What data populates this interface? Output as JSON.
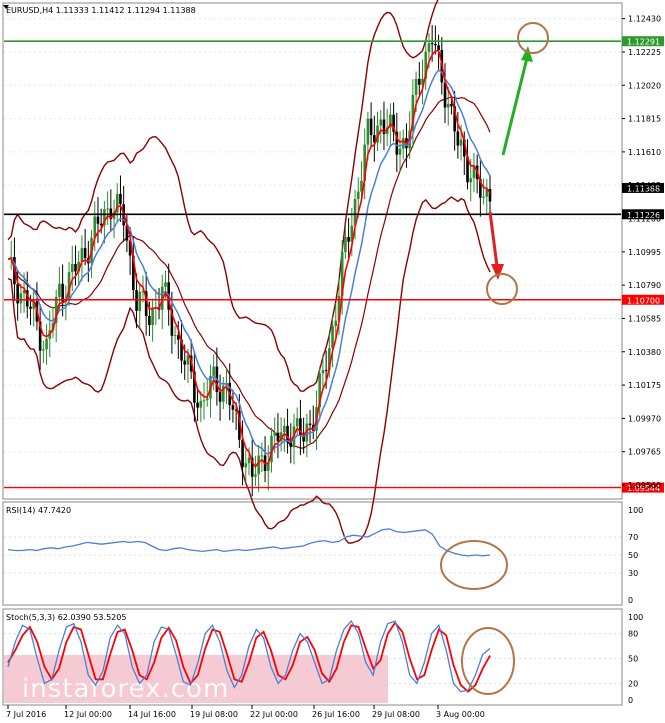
{
  "window": {
    "symbol_header": "EURUSD,H4  1.11333 1.11412 1.11294 1.11388"
  },
  "price_axis": {
    "ticks": [
      "1.12430",
      "1.12225",
      "1.12020",
      "1.11815",
      "1.11610",
      "1.11405",
      "1.11200",
      "1.10995",
      "1.10790",
      "1.10585",
      "1.10380",
      "1.10175",
      "1.09970",
      "1.09765",
      "1.09560"
    ],
    "price_min": 1.0948,
    "price_max": 1.1252
  },
  "levels": {
    "resistance": {
      "label": "1.12291",
      "price": 1.12291,
      "color": "#2e9a2e"
    },
    "current": {
      "label": "1.11388",
      "price": 1.11388,
      "color": "#000000"
    },
    "pivot": {
      "label": "1.11226",
      "price": 1.11226,
      "color": "#000000"
    },
    "support1": {
      "label": "1.10700",
      "price": 1.107,
      "color": "#ff0000"
    },
    "support2": {
      "label": "1.09544",
      "price": 1.09544,
      "color": "#ff0000"
    }
  },
  "rsi": {
    "header": "RSI(14) 47.7420",
    "ticks": [
      "100",
      "70",
      "50",
      "30",
      "0"
    ],
    "values": [
      56,
      55,
      55,
      56,
      55,
      57,
      58,
      57,
      59,
      60,
      62,
      64,
      63,
      62,
      63,
      64,
      65,
      64,
      65,
      64,
      60,
      56,
      55,
      57,
      58,
      56,
      55,
      54,
      55,
      56,
      54,
      55,
      56,
      55,
      56,
      57,
      58,
      59,
      57,
      58,
      59,
      60,
      63,
      65,
      66,
      64,
      65,
      70,
      72,
      71,
      70,
      74,
      78,
      79,
      76,
      75,
      76,
      77,
      78,
      73,
      60,
      55,
      52,
      50,
      49,
      50,
      49,
      50
    ]
  },
  "stoch": {
    "header": "Stoch(5,3,3) 62.0390 53.5205",
    "ticks": [
      "100",
      "80",
      "50",
      "20",
      "0"
    ],
    "main": [
      40,
      70,
      90,
      85,
      50,
      20,
      25,
      60,
      88,
      92,
      70,
      30,
      18,
      35,
      75,
      90,
      80,
      40,
      20,
      30,
      70,
      88,
      85,
      55,
      22,
      18,
      45,
      80,
      90,
      70,
      35,
      15,
      30,
      65,
      85,
      75,
      40,
      20,
      30,
      60,
      80,
      70,
      45,
      20,
      25,
      60,
      85,
      95,
      80,
      45,
      30,
      70,
      92,
      95,
      70,
      30,
      20,
      45,
      80,
      90,
      60,
      20,
      10,
      12,
      30,
      55,
      62
    ],
    "signal": [
      45,
      60,
      78,
      88,
      70,
      40,
      25,
      38,
      70,
      88,
      85,
      55,
      25,
      25,
      55,
      82,
      85,
      60,
      30,
      25,
      45,
      75,
      87,
      72,
      40,
      20,
      30,
      62,
      85,
      82,
      55,
      25,
      22,
      45,
      75,
      82,
      60,
      30,
      25,
      42,
      70,
      76,
      60,
      32,
      22,
      38,
      70,
      90,
      88,
      62,
      38,
      48,
      80,
      93,
      82,
      50,
      25,
      30,
      60,
      85,
      78,
      42,
      18,
      10,
      18,
      38,
      53.5
    ]
  },
  "time_axis": [
    "7 Jul 2016",
    "12 Jul 00:00",
    "14 Jul 16:00",
    "19 Jul 08:00",
    "22 Jul 00:00",
    "26 Jul 16:00",
    "29 Jul 08:00",
    "3 Aug 00:00"
  ],
  "watermark": "instaforex.com",
  "colors": {
    "bull_candle": "#2e8b2e",
    "bear_candle": "#000000",
    "ema_fast": "#ff0000",
    "ema_slow": "#4a7fd8",
    "bollinger": "#8b0000",
    "rsi_line": "#4a7fd8",
    "stoch_main": "#4a7fd8",
    "stoch_signal": "#ff0000",
    "forecast_up": "#22b022",
    "forecast_down": "#e02020",
    "target_circle": "#b0764a"
  }
}
